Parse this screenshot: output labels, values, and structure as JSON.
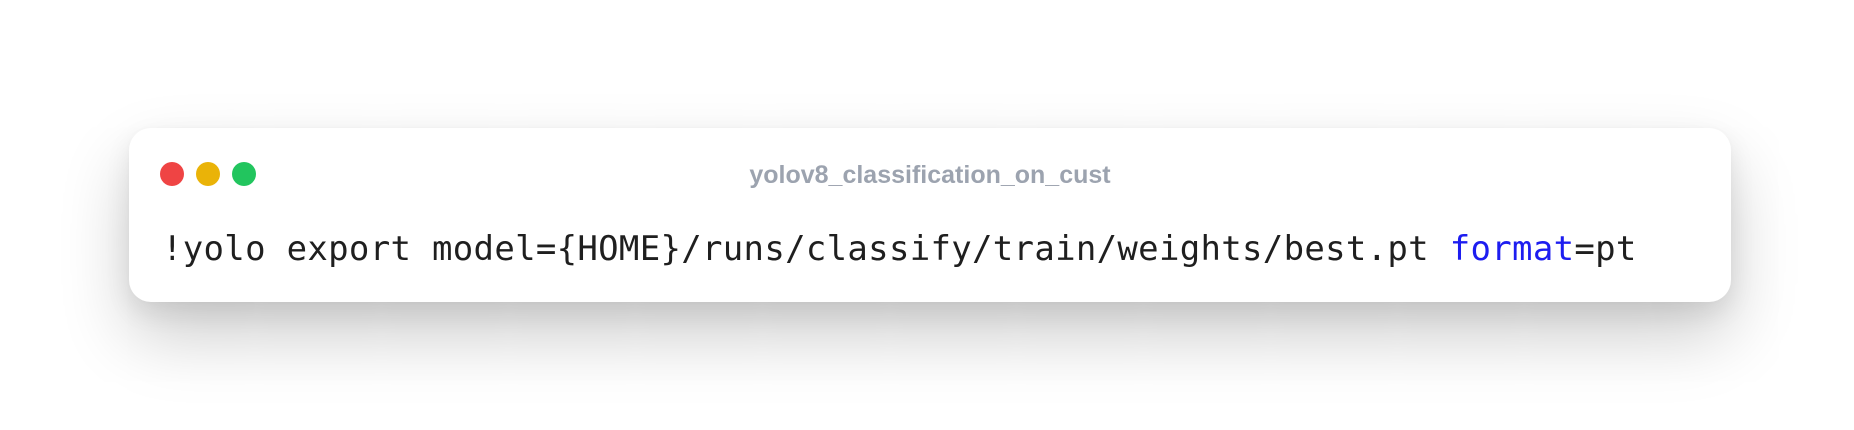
{
  "window": {
    "title": "yolov8_classification_on_cust",
    "controls": [
      {
        "name": "close",
        "color": "#ef4444"
      },
      {
        "name": "minimize",
        "color": "#eab308"
      },
      {
        "name": "maximize",
        "color": "#22c55e"
      }
    ]
  },
  "code": {
    "prefix": "!yolo export model={HOME}/runs/classify/train/weights/best.pt ",
    "keyword": "format",
    "suffix": "=pt",
    "keyword_color": "#1d1df0"
  }
}
